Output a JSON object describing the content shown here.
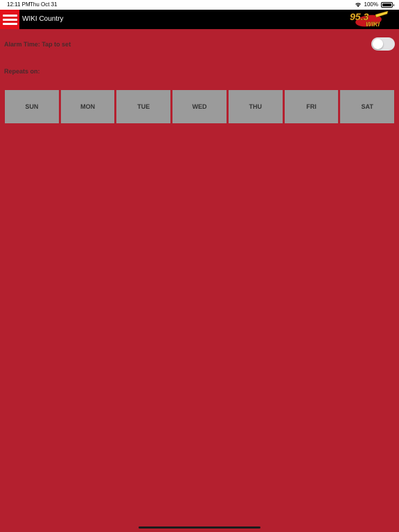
{
  "status_bar": {
    "time": "12:11 PM",
    "date": "Thu Oct 31",
    "battery": "100%",
    "wifi_icon": "wifi-icon",
    "battery_icon": "battery-icon"
  },
  "header": {
    "menu_icon": "hamburger-menu-icon",
    "title": "WIKI Country",
    "logo_text_top": "95.3",
    "logo_text_bottom": "WIKI",
    "background": "#000000",
    "menu_color": "#e3111b"
  },
  "alarm": {
    "label": "Alarm Time: Tap to set",
    "toggle_on": false
  },
  "repeats": {
    "label": "Repeats on:",
    "days": [
      {
        "label": "SUN"
      },
      {
        "label": "MON"
      },
      {
        "label": "TUE"
      },
      {
        "label": "WED"
      },
      {
        "label": "THU"
      },
      {
        "label": "FRI"
      },
      {
        "label": "SAT"
      }
    ]
  },
  "colors": {
    "background": "#b4202f",
    "day_button": "#9b9b9b",
    "day_text": "#333333",
    "toggle_off": "#e2e2e4"
  }
}
